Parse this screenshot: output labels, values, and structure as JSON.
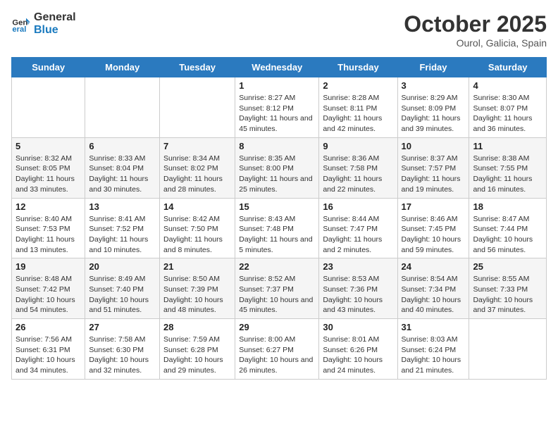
{
  "header": {
    "logo_line1": "General",
    "logo_line2": "Blue",
    "month": "October 2025",
    "location": "Ourol, Galicia, Spain"
  },
  "weekdays": [
    "Sunday",
    "Monday",
    "Tuesday",
    "Wednesday",
    "Thursday",
    "Friday",
    "Saturday"
  ],
  "weeks": [
    [
      {
        "day": "",
        "sunrise": "",
        "sunset": "",
        "daylight": ""
      },
      {
        "day": "",
        "sunrise": "",
        "sunset": "",
        "daylight": ""
      },
      {
        "day": "",
        "sunrise": "",
        "sunset": "",
        "daylight": ""
      },
      {
        "day": "1",
        "sunrise": "Sunrise: 8:27 AM",
        "sunset": "Sunset: 8:12 PM",
        "daylight": "Daylight: 11 hours and 45 minutes."
      },
      {
        "day": "2",
        "sunrise": "Sunrise: 8:28 AM",
        "sunset": "Sunset: 8:11 PM",
        "daylight": "Daylight: 11 hours and 42 minutes."
      },
      {
        "day": "3",
        "sunrise": "Sunrise: 8:29 AM",
        "sunset": "Sunset: 8:09 PM",
        "daylight": "Daylight: 11 hours and 39 minutes."
      },
      {
        "day": "4",
        "sunrise": "Sunrise: 8:30 AM",
        "sunset": "Sunset: 8:07 PM",
        "daylight": "Daylight: 11 hours and 36 minutes."
      }
    ],
    [
      {
        "day": "5",
        "sunrise": "Sunrise: 8:32 AM",
        "sunset": "Sunset: 8:05 PM",
        "daylight": "Daylight: 11 hours and 33 minutes."
      },
      {
        "day": "6",
        "sunrise": "Sunrise: 8:33 AM",
        "sunset": "Sunset: 8:04 PM",
        "daylight": "Daylight: 11 hours and 30 minutes."
      },
      {
        "day": "7",
        "sunrise": "Sunrise: 8:34 AM",
        "sunset": "Sunset: 8:02 PM",
        "daylight": "Daylight: 11 hours and 28 minutes."
      },
      {
        "day": "8",
        "sunrise": "Sunrise: 8:35 AM",
        "sunset": "Sunset: 8:00 PM",
        "daylight": "Daylight: 11 hours and 25 minutes."
      },
      {
        "day": "9",
        "sunrise": "Sunrise: 8:36 AM",
        "sunset": "Sunset: 7:58 PM",
        "daylight": "Daylight: 11 hours and 22 minutes."
      },
      {
        "day": "10",
        "sunrise": "Sunrise: 8:37 AM",
        "sunset": "Sunset: 7:57 PM",
        "daylight": "Daylight: 11 hours and 19 minutes."
      },
      {
        "day": "11",
        "sunrise": "Sunrise: 8:38 AM",
        "sunset": "Sunset: 7:55 PM",
        "daylight": "Daylight: 11 hours and 16 minutes."
      }
    ],
    [
      {
        "day": "12",
        "sunrise": "Sunrise: 8:40 AM",
        "sunset": "Sunset: 7:53 PM",
        "daylight": "Daylight: 11 hours and 13 minutes."
      },
      {
        "day": "13",
        "sunrise": "Sunrise: 8:41 AM",
        "sunset": "Sunset: 7:52 PM",
        "daylight": "Daylight: 11 hours and 10 minutes."
      },
      {
        "day": "14",
        "sunrise": "Sunrise: 8:42 AM",
        "sunset": "Sunset: 7:50 PM",
        "daylight": "Daylight: 11 hours and 8 minutes."
      },
      {
        "day": "15",
        "sunrise": "Sunrise: 8:43 AM",
        "sunset": "Sunset: 7:48 PM",
        "daylight": "Daylight: 11 hours and 5 minutes."
      },
      {
        "day": "16",
        "sunrise": "Sunrise: 8:44 AM",
        "sunset": "Sunset: 7:47 PM",
        "daylight": "Daylight: 11 hours and 2 minutes."
      },
      {
        "day": "17",
        "sunrise": "Sunrise: 8:46 AM",
        "sunset": "Sunset: 7:45 PM",
        "daylight": "Daylight: 10 hours and 59 minutes."
      },
      {
        "day": "18",
        "sunrise": "Sunrise: 8:47 AM",
        "sunset": "Sunset: 7:44 PM",
        "daylight": "Daylight: 10 hours and 56 minutes."
      }
    ],
    [
      {
        "day": "19",
        "sunrise": "Sunrise: 8:48 AM",
        "sunset": "Sunset: 7:42 PM",
        "daylight": "Daylight: 10 hours and 54 minutes."
      },
      {
        "day": "20",
        "sunrise": "Sunrise: 8:49 AM",
        "sunset": "Sunset: 7:40 PM",
        "daylight": "Daylight: 10 hours and 51 minutes."
      },
      {
        "day": "21",
        "sunrise": "Sunrise: 8:50 AM",
        "sunset": "Sunset: 7:39 PM",
        "daylight": "Daylight: 10 hours and 48 minutes."
      },
      {
        "day": "22",
        "sunrise": "Sunrise: 8:52 AM",
        "sunset": "Sunset: 7:37 PM",
        "daylight": "Daylight: 10 hours and 45 minutes."
      },
      {
        "day": "23",
        "sunrise": "Sunrise: 8:53 AM",
        "sunset": "Sunset: 7:36 PM",
        "daylight": "Daylight: 10 hours and 43 minutes."
      },
      {
        "day": "24",
        "sunrise": "Sunrise: 8:54 AM",
        "sunset": "Sunset: 7:34 PM",
        "daylight": "Daylight: 10 hours and 40 minutes."
      },
      {
        "day": "25",
        "sunrise": "Sunrise: 8:55 AM",
        "sunset": "Sunset: 7:33 PM",
        "daylight": "Daylight: 10 hours and 37 minutes."
      }
    ],
    [
      {
        "day": "26",
        "sunrise": "Sunrise: 7:56 AM",
        "sunset": "Sunset: 6:31 PM",
        "daylight": "Daylight: 10 hours and 34 minutes."
      },
      {
        "day": "27",
        "sunrise": "Sunrise: 7:58 AM",
        "sunset": "Sunset: 6:30 PM",
        "daylight": "Daylight: 10 hours and 32 minutes."
      },
      {
        "day": "28",
        "sunrise": "Sunrise: 7:59 AM",
        "sunset": "Sunset: 6:28 PM",
        "daylight": "Daylight: 10 hours and 29 minutes."
      },
      {
        "day": "29",
        "sunrise": "Sunrise: 8:00 AM",
        "sunset": "Sunset: 6:27 PM",
        "daylight": "Daylight: 10 hours and 26 minutes."
      },
      {
        "day": "30",
        "sunrise": "Sunrise: 8:01 AM",
        "sunset": "Sunset: 6:26 PM",
        "daylight": "Daylight: 10 hours and 24 minutes."
      },
      {
        "day": "31",
        "sunrise": "Sunrise: 8:03 AM",
        "sunset": "Sunset: 6:24 PM",
        "daylight": "Daylight: 10 hours and 21 minutes."
      },
      {
        "day": "",
        "sunrise": "",
        "sunset": "",
        "daylight": ""
      }
    ]
  ]
}
